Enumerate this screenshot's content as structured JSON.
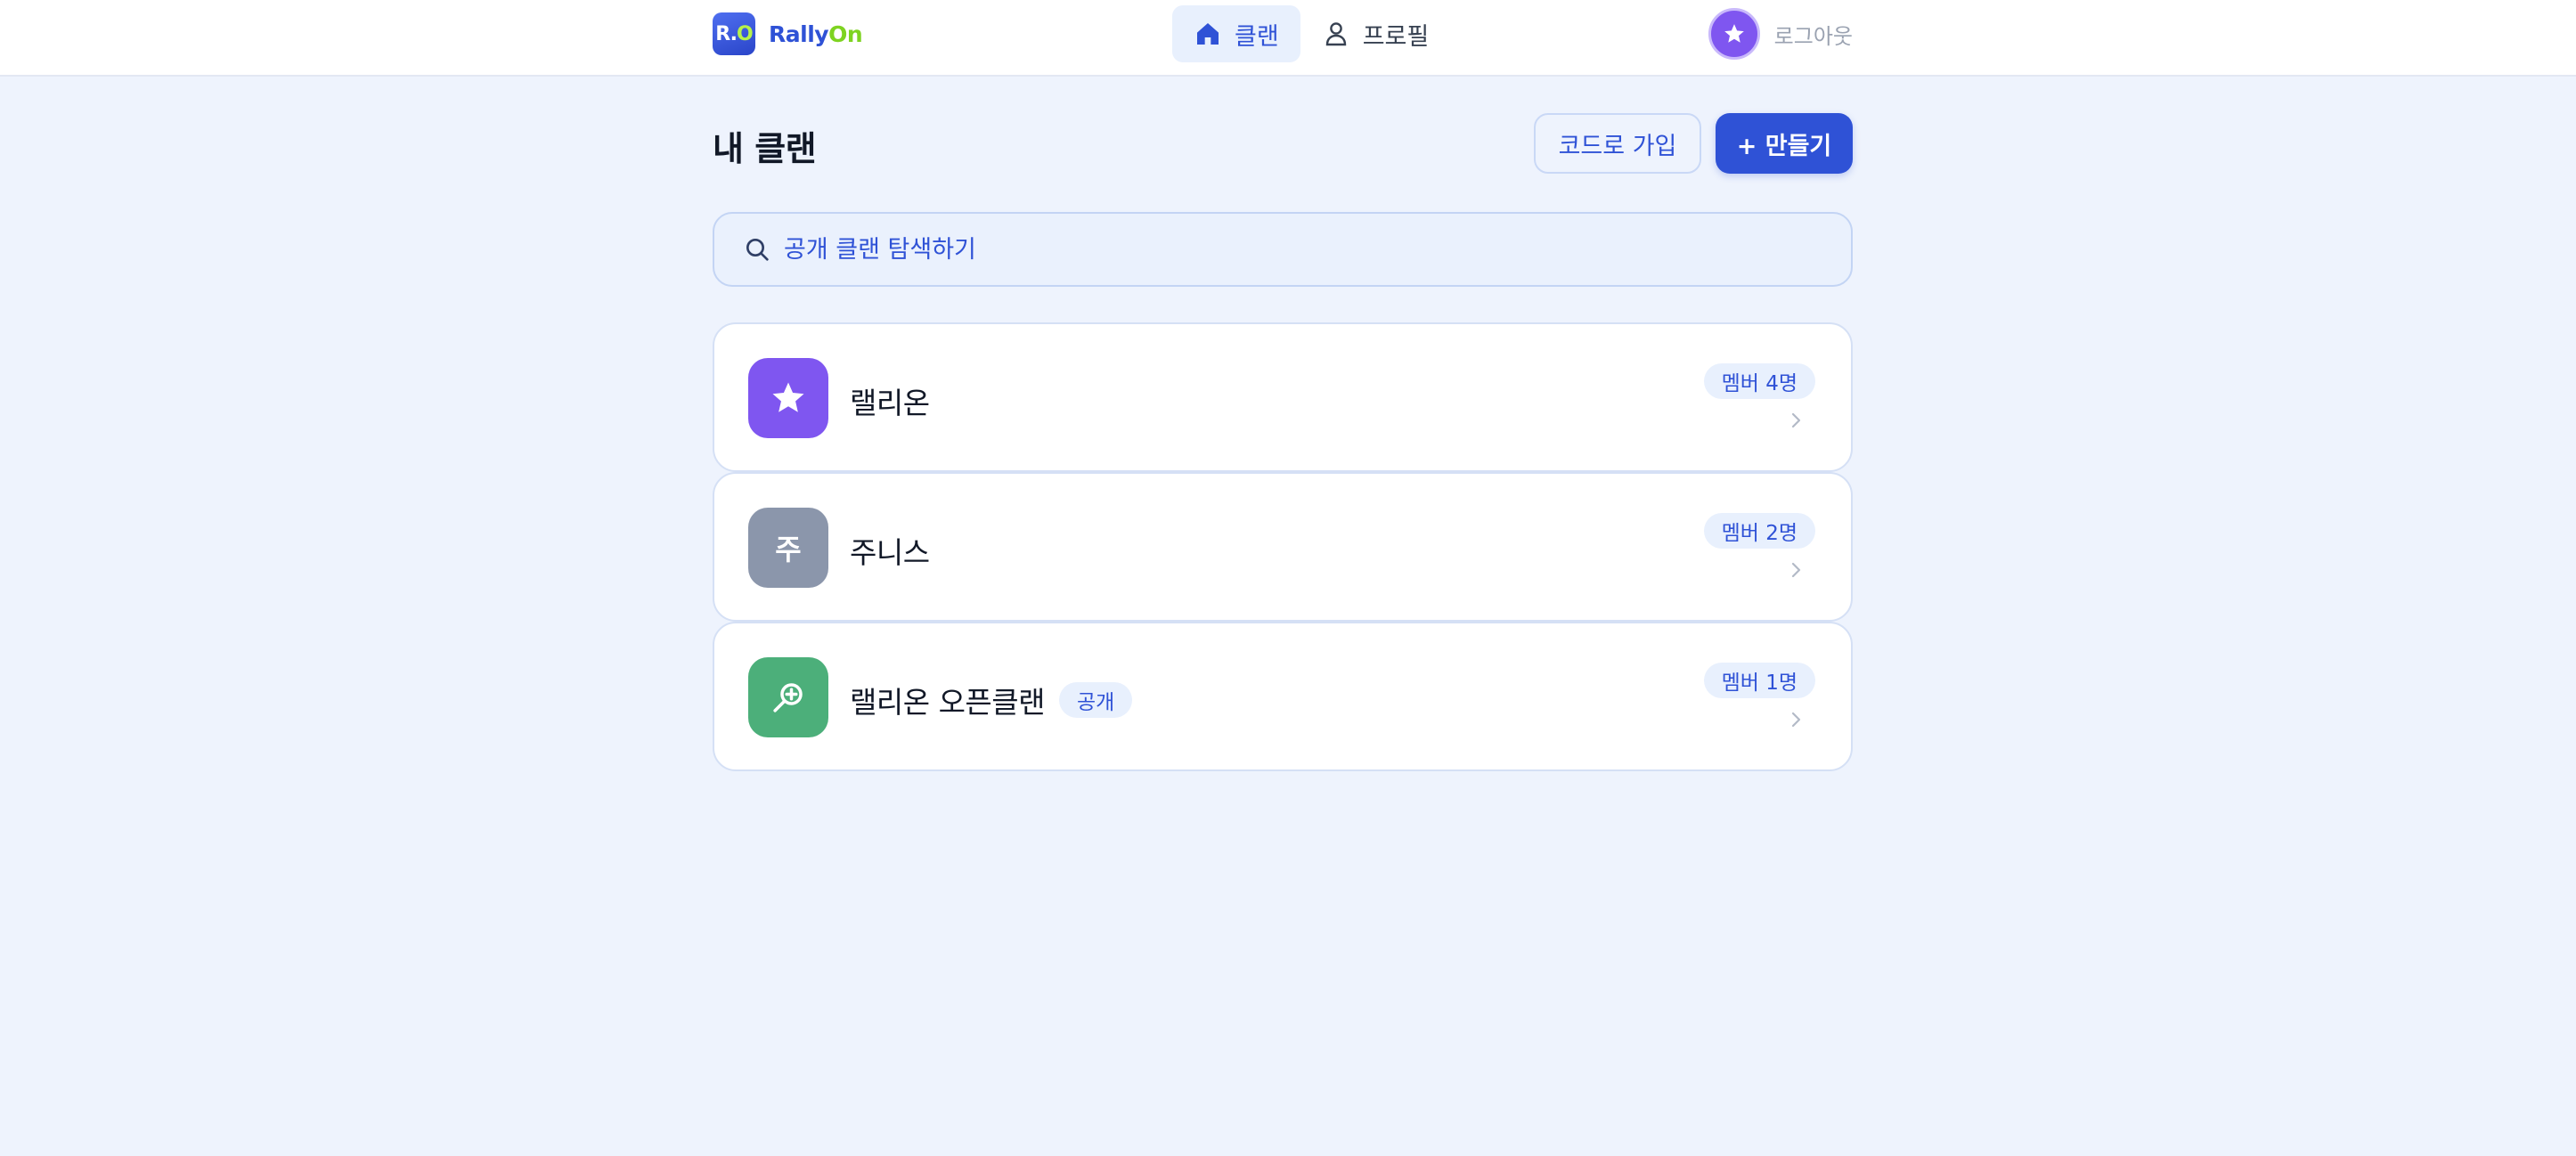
{
  "brand": {
    "logo_text_main": "R.",
    "logo_text_accent": "O",
    "name_main": "Rally",
    "name_accent": "On"
  },
  "nav": {
    "items": [
      {
        "label": "클랜",
        "icon": "home-icon",
        "active": true
      },
      {
        "label": "프로필",
        "icon": "user-icon",
        "active": false
      }
    ]
  },
  "user": {
    "avatar_icon": "star-icon",
    "logout_label": "로그아웃"
  },
  "page": {
    "title": "내 클랜",
    "join_by_code_label": "코드로 가입",
    "create_label": "+ 만들기"
  },
  "search": {
    "placeholder": "공개 클랜 탐색하기"
  },
  "clans": [
    {
      "name": "랠리온",
      "icon": "star-icon",
      "icon_color": "#7f56f0",
      "members": "멤버 4명",
      "public": false
    },
    {
      "name": "주니스",
      "icon_text": "주",
      "icon_color": "#8b96ab",
      "members": "멤버 2명",
      "public": false
    },
    {
      "name": "랠리온 오픈클랜",
      "icon": "search-plus-icon",
      "icon_color": "#4caf7a",
      "members": "멤버 1명",
      "public": true,
      "public_label": "공개"
    }
  ],
  "colors": {
    "accent": "#2f52d6",
    "background": "#eef3fd",
    "brand_green": "#7ed321"
  }
}
